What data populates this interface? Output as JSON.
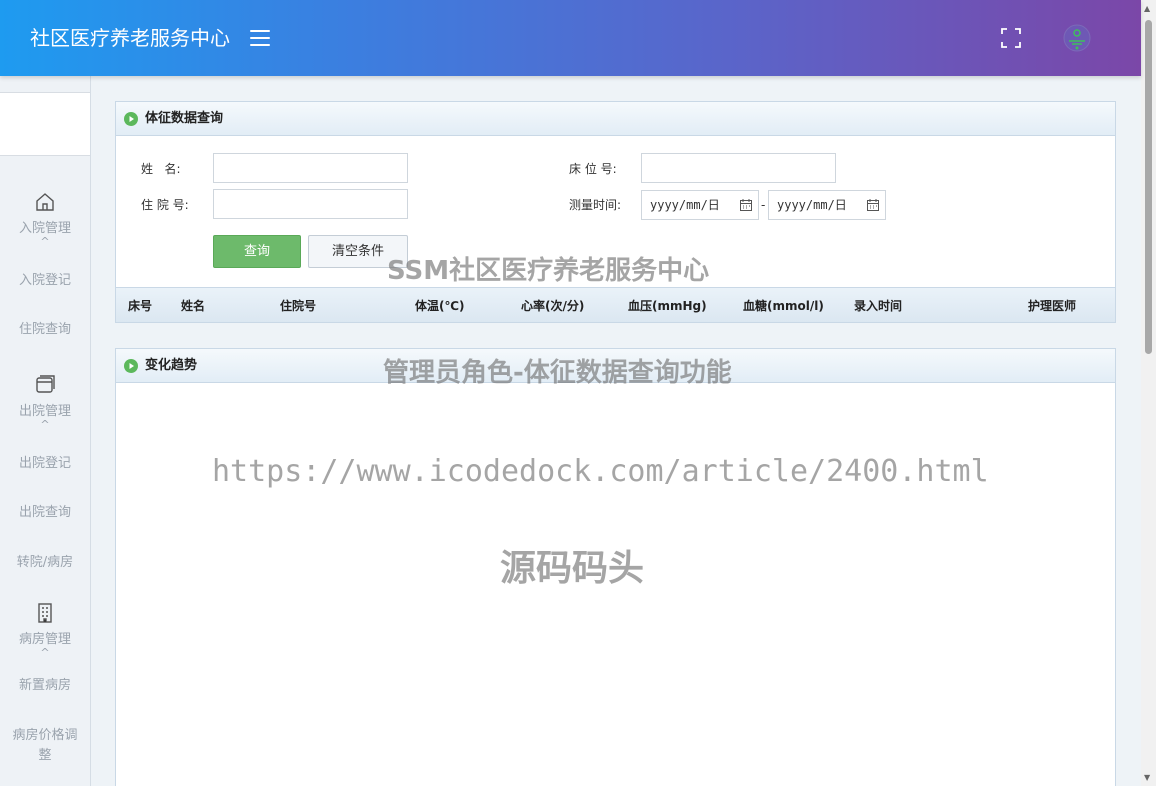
{
  "header": {
    "title": "社区医疗养老服务中心",
    "menu_icon": "hamburger-icon",
    "fullscreen_icon": "fullscreen-icon",
    "avatar_icon": "avatar-icon"
  },
  "sidebar": {
    "groups": [
      {
        "label": "入院管理",
        "icon": "home-icon",
        "items": [
          "入院登记",
          "住院查询"
        ]
      },
      {
        "label": "出院管理",
        "icon": "window-icon",
        "items": [
          "出院登记",
          "出院查询",
          "转院/病房"
        ]
      },
      {
        "label": "病房管理",
        "icon": "building-icon",
        "items": [
          "新置病房",
          "病房价格调整"
        ]
      }
    ],
    "caret": "^"
  },
  "query_panel": {
    "title": "体征数据查询",
    "fields": {
      "name_label": "姓   名:",
      "bed_label": "床 位 号:",
      "admission_label": "住 院 号:",
      "time_label": "测量时间:",
      "date_from": "yyyy/mm/日",
      "date_to": "yyyy/mm/日",
      "date_separator": "-"
    },
    "buttons": {
      "search": "查询",
      "clear": "清空条件"
    },
    "table_headers": [
      "床号",
      "姓名",
      "住院号",
      "体温(℃)",
      "心率(次/分)",
      "血压(mmHg)",
      "血糖(mmol/l)",
      "录入时间",
      "护理医师"
    ]
  },
  "trend_panel": {
    "title": "变化趋势"
  },
  "watermark": {
    "line1": "SSM社区医疗养老服务中心",
    "line2": "管理员角色-体征数据查询功能",
    "line3": "https://www.icodedock.com/article/2400.html",
    "line4": "源码码头"
  },
  "colors": {
    "header_start": "#1e9bf0",
    "header_end": "#7b47a8",
    "search_button": "#6dba6b",
    "sidebar_text": "#9aa3ad"
  }
}
